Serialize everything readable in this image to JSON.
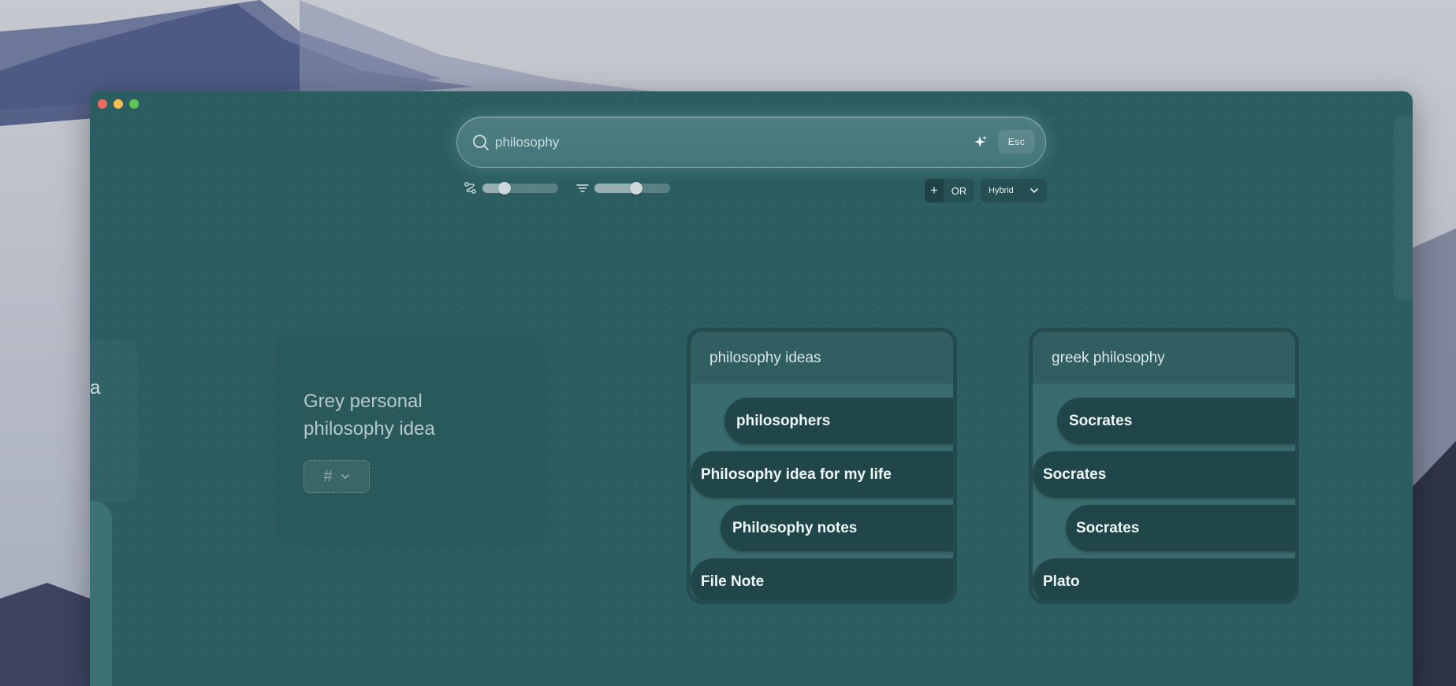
{
  "window": {
    "controls": [
      "close",
      "minimize",
      "maximize"
    ]
  },
  "search": {
    "value": "philosophy",
    "icon": "magnifier",
    "ai_icon": "sparkle",
    "esc_label": "Esc"
  },
  "controls": {
    "similarity_slider": {
      "icon": "connection-nodes",
      "level": 0.25
    },
    "filter_slider": {
      "icon": "filter-lines",
      "level": 0.56
    },
    "plus_label": "+",
    "logic_label": "OR",
    "mode_selected": "Hybrid"
  },
  "partial_card": {
    "letter": "a"
  },
  "grey_card": {
    "title": "Grey personal philosophy idea",
    "tag_symbol": "#"
  },
  "clusters": [
    {
      "title": "philosophy ideas",
      "notes": [
        "philosophers",
        "Philosophy idea for my life",
        "Philosophy notes",
        "File Note"
      ]
    },
    {
      "title": "greek philosophy",
      "notes": [
        "Socrates",
        "Socrates",
        "Socrates",
        "Plato"
      ]
    }
  ],
  "colors": {
    "window_bg": "#2c5d60",
    "pill_bg": "#214649",
    "accent_text": "#eef5f5"
  }
}
